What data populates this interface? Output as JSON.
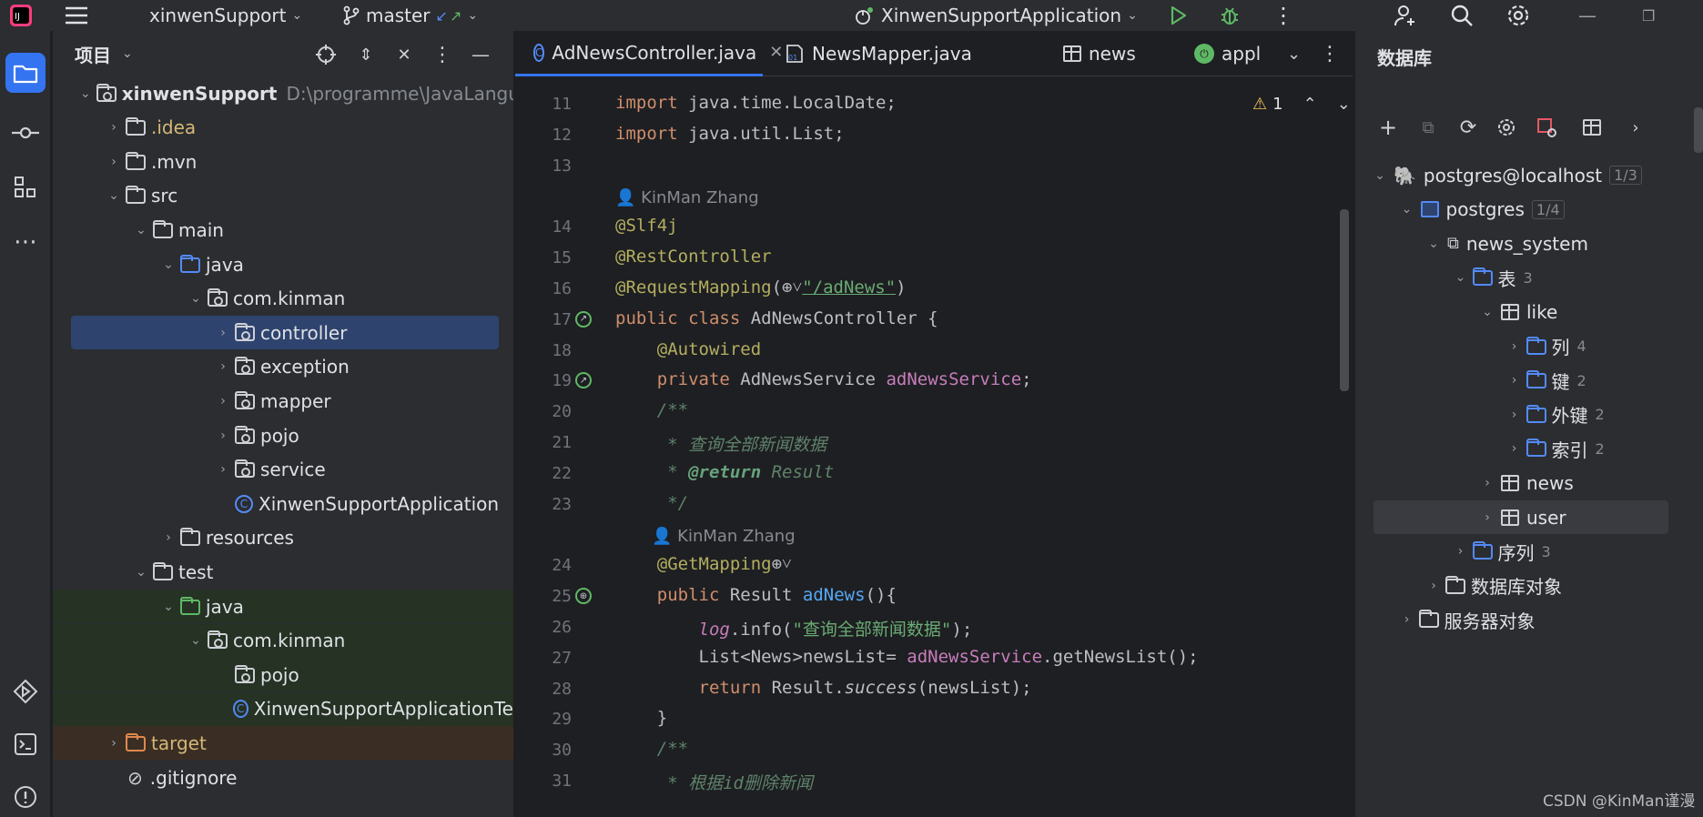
{
  "titlebar": {
    "project": "xinwenSupport",
    "branch": "master",
    "run_config": "XinwenSupportApplication"
  },
  "project_panel": {
    "title": "项目",
    "tree": [
      {
        "label": "xinwenSupport",
        "extra": "D:\\programme\\JavaLanguage",
        "depth": 0,
        "open": true,
        "icon": "module"
      },
      {
        "label": ".idea",
        "depth": 1,
        "open": false,
        "icon": "folder",
        "color": "#d5b778"
      },
      {
        "label": ".mvn",
        "depth": 1,
        "open": false,
        "icon": "folder"
      },
      {
        "label": "src",
        "depth": 1,
        "open": true,
        "icon": "folder"
      },
      {
        "label": "main",
        "depth": 2,
        "open": true,
        "icon": "folder"
      },
      {
        "label": "java",
        "depth": 3,
        "open": true,
        "icon": "folder-blue"
      },
      {
        "label": "com.kinman",
        "depth": 4,
        "open": true,
        "icon": "package"
      },
      {
        "label": "controller",
        "depth": 5,
        "open": false,
        "icon": "package",
        "selected": true
      },
      {
        "label": "exception",
        "depth": 5,
        "open": false,
        "icon": "package"
      },
      {
        "label": "mapper",
        "depth": 5,
        "open": false,
        "icon": "package"
      },
      {
        "label": "pojo",
        "depth": 5,
        "open": false,
        "icon": "package"
      },
      {
        "label": "service",
        "depth": 5,
        "open": false,
        "icon": "package"
      },
      {
        "label": "XinwenSupportApplication",
        "depth": 5,
        "leaf": true,
        "icon": "class"
      },
      {
        "label": "resources",
        "depth": 3,
        "open": false,
        "icon": "folder-res"
      },
      {
        "label": "test",
        "depth": 2,
        "open": true,
        "icon": "folder"
      },
      {
        "label": "java",
        "depth": 3,
        "open": true,
        "icon": "folder-green",
        "bg": "#253224"
      },
      {
        "label": "com.kinman",
        "depth": 4,
        "open": true,
        "icon": "package",
        "bg": "#253224"
      },
      {
        "label": "pojo",
        "depth": 5,
        "leaf": true,
        "icon": "package",
        "bg": "#253224"
      },
      {
        "label": "XinwenSupportApplicationTe",
        "depth": 5,
        "leaf": true,
        "icon": "class",
        "bg": "#253224"
      },
      {
        "label": "target",
        "depth": 1,
        "open": false,
        "icon": "folder-orange",
        "color": "#d5b778",
        "bg": "#3a2e24"
      },
      {
        "label": ".gitignore",
        "depth": 1,
        "leaf": true,
        "icon": "ignore"
      }
    ]
  },
  "editor": {
    "tabs": [
      {
        "label": "AdNewsController.java",
        "active": true
      },
      {
        "label": "NewsMapper.java"
      },
      {
        "label": "news"
      },
      {
        "label": "appl"
      }
    ],
    "warnings": "1",
    "author": "KinMan Zhang",
    "lines": [
      {
        "n": "11",
        "html": "<span class='kw'>import</span> java.time.LocalDate;"
      },
      {
        "n": "12",
        "html": "<span class='kw'>import</span> java.util.List;"
      },
      {
        "n": "13",
        "html": ""
      },
      {
        "author": true
      },
      {
        "n": "14",
        "html": "<span class='ann'>@Slf4j</span>"
      },
      {
        "n": "15",
        "html": "<span class='ann'>@RestController</span>"
      },
      {
        "n": "16",
        "html": "<span class='ann'>@RequestMapping</span>(⊕˅<span class='link'>\"/adNews\"</span>)"
      },
      {
        "n": "17",
        "html": "<span class='kw'>public class</span> AdNewsController {",
        "mark": "bean"
      },
      {
        "n": "18",
        "html": "    <span class='ann'>@Autowired</span>"
      },
      {
        "n": "19",
        "html": "    <span class='kw'>private</span> AdNewsService <span class='fld'>adNewsService</span>;",
        "mark": "bean"
      },
      {
        "n": "20",
        "html": "    <span class='doc'>/**</span>"
      },
      {
        "n": "21",
        "html": "<span class='doc'>     * 查询全部新闻数据</span>"
      },
      {
        "n": "22",
        "html": "<span class='doc'>     * </span><span class='dtag'>@return</span><span class='doc'> Result</span>"
      },
      {
        "n": "23",
        "html": "<span class='doc'>     */</span>"
      },
      {
        "author": true,
        "indent": true
      },
      {
        "n": "24",
        "html": "    <span class='ann'>@GetMapping</span>⊕˅"
      },
      {
        "n": "25",
        "html": "    <span class='kw'>public</span> Result <span class='fn'>adNews</span>(){",
        "mark": "web"
      },
      {
        "n": "26",
        "html": "        <span class='fld' style='font-style:italic'>log</span>.info(<span class='str'>\"查询全部新闻数据\"</span>);"
      },
      {
        "n": "27",
        "html": "        List&lt;News&gt;newsList= <span class='fld'>adNewsService</span>.getNewsList();"
      },
      {
        "n": "28",
        "html": "        <span class='kw'>return</span> Result.<span style='font-style:italic'>success</span>(newsList);"
      },
      {
        "n": "29",
        "html": "    }"
      },
      {
        "n": "30",
        "html": "    <span class='doc'>/**</span>"
      },
      {
        "n": "31",
        "html": "<span class='doc'>     * 根据id删除新闻</span>"
      }
    ]
  },
  "db_panel": {
    "title": "数据库",
    "tree": [
      {
        "label": "postgres@localhost",
        "badge": "1/3",
        "x": 0,
        "open": true,
        "icon": "pg"
      },
      {
        "label": "postgres",
        "badge": "1/4",
        "x": 1,
        "open": true,
        "icon": "db"
      },
      {
        "label": "news_system",
        "x": 2,
        "open": true,
        "icon": "schema"
      },
      {
        "label": "表",
        "count": "3",
        "x": 3,
        "open": true,
        "icon": "folder-blue"
      },
      {
        "label": "like",
        "x": 4,
        "open": true,
        "icon": "table"
      },
      {
        "label": "列",
        "count": "4",
        "x": 5,
        "open": false,
        "icon": "folder-blue"
      },
      {
        "label": "键",
        "count": "2",
        "x": 5,
        "open": false,
        "icon": "folder-blue"
      },
      {
        "label": "外键",
        "count": "2",
        "x": 5,
        "open": false,
        "icon": "folder-blue"
      },
      {
        "label": "索引",
        "count": "2",
        "x": 5,
        "open": false,
        "icon": "folder-blue"
      },
      {
        "label": "news",
        "x": 4,
        "open": false,
        "icon": "table"
      },
      {
        "label": "user",
        "x": 4,
        "open": false,
        "icon": "table",
        "selected": true
      },
      {
        "label": "序列",
        "count": "3",
        "x": 3,
        "open": false,
        "icon": "folder-blue"
      },
      {
        "label": "数据库对象",
        "x": 2,
        "open": false,
        "icon": "folder-db"
      },
      {
        "label": "服务器对象",
        "x": 1,
        "open": false,
        "icon": "folder-db"
      }
    ]
  },
  "watermark": "CSDN @KinMan谨漫"
}
